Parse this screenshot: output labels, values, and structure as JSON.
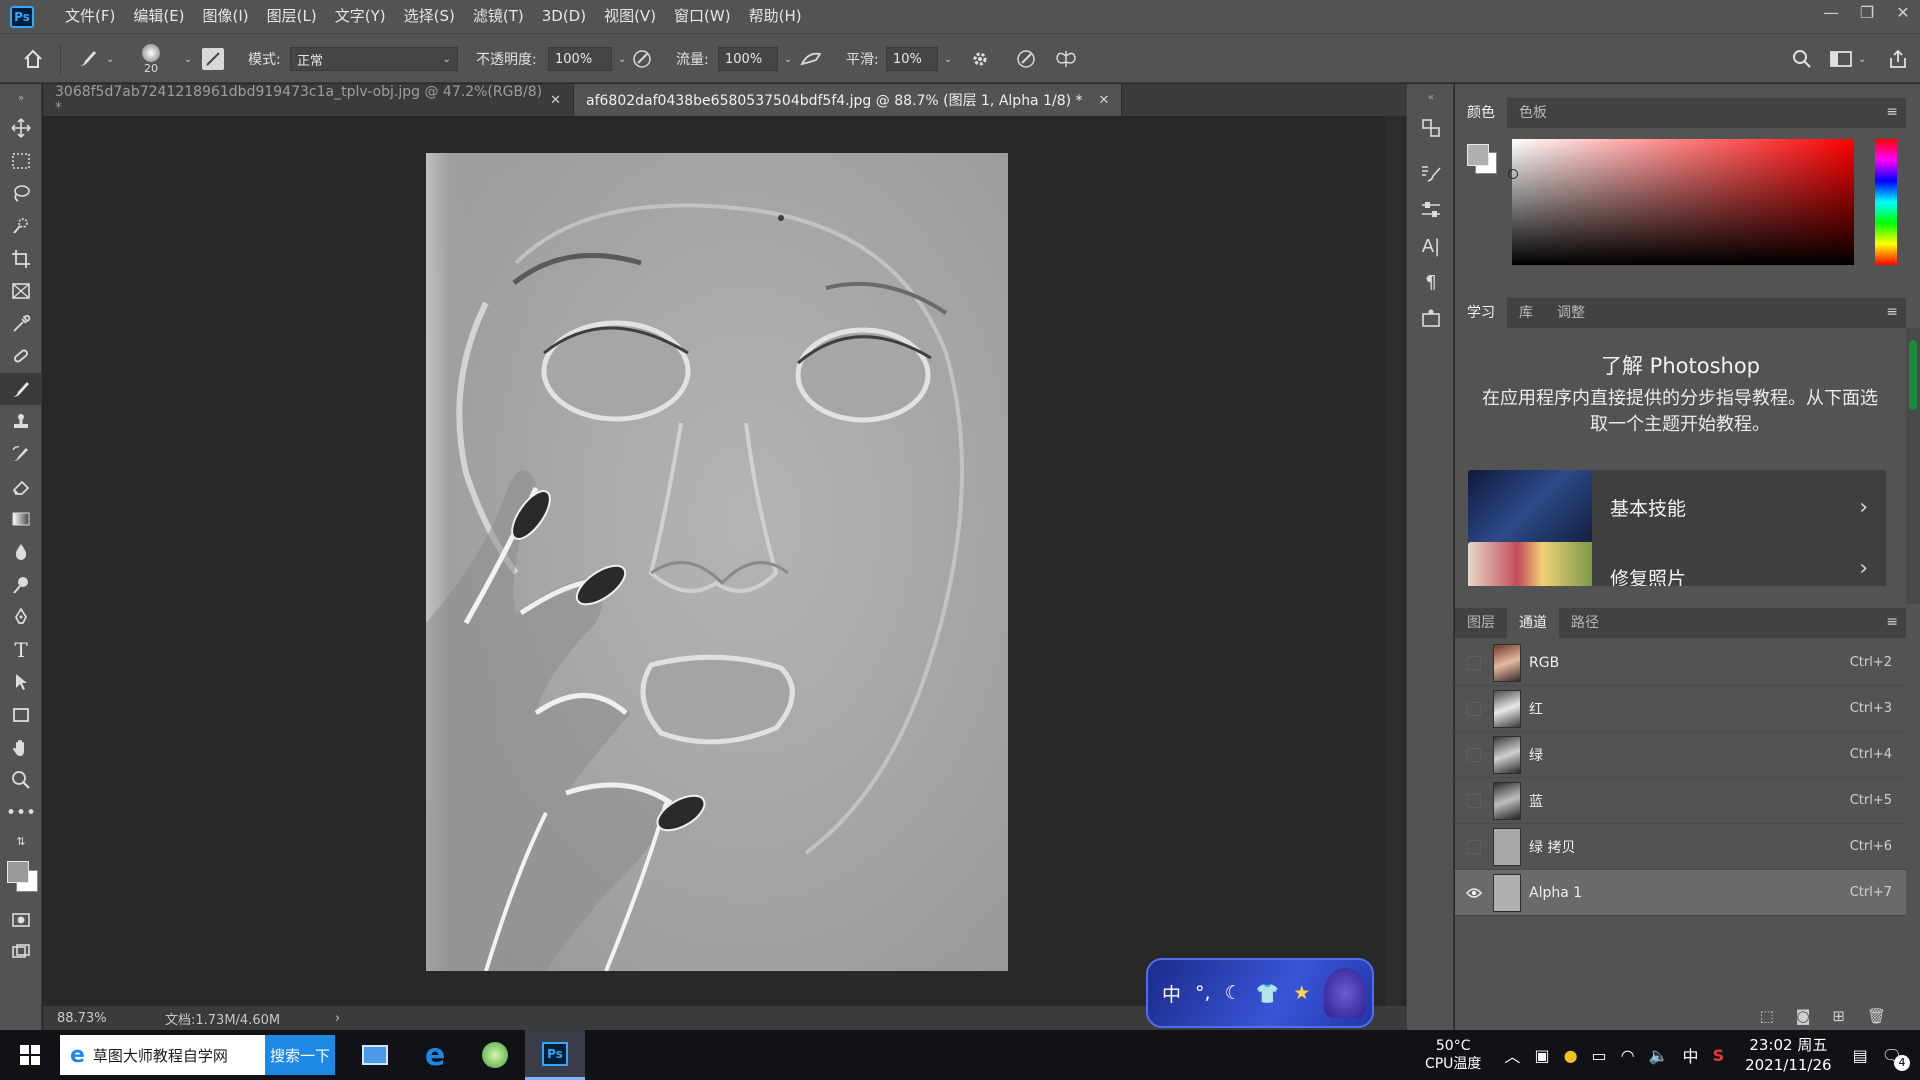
{
  "app": {
    "logo": "Ps"
  },
  "menu": [
    "文件(F)",
    "编辑(E)",
    "图像(I)",
    "图层(L)",
    "文字(Y)",
    "选择(S)",
    "滤镜(T)",
    "3D(D)",
    "视图(V)",
    "窗口(W)",
    "帮助(H)"
  ],
  "window_controls": {
    "minimize": "—",
    "restore": "❐",
    "close": "✕"
  },
  "options": {
    "brush_size": "20",
    "mode_label": "模式:",
    "mode_value": "正常",
    "opacity_label": "不透明度:",
    "opacity_value": "100%",
    "flow_label": "流量:",
    "flow_value": "100%",
    "smoothing_label": "平滑:",
    "smoothing_value": "10%"
  },
  "tabs": [
    {
      "label": "3068f5d7ab7241218961dbd919473c1a_tplv-obj.jpg @ 47.2%(RGB/8) *",
      "close": "✕",
      "active": false
    },
    {
      "label": "af6802daf0438be6580537504bdf5f4.jpg  @ 88.7% (图层 1, Alpha 1/8) *",
      "close": "✕",
      "active": true
    }
  ],
  "status": {
    "zoom": "88.73%",
    "doc": "文档:1.73M/4.60M",
    "arrow": "›"
  },
  "color_panel": {
    "tabs": [
      "颜色",
      "色板"
    ]
  },
  "learn_panel": {
    "tabs": [
      "学习",
      "库",
      "调整"
    ],
    "title": "了解 Photoshop",
    "description": "在应用程序内直接提供的分步指导教程。从下面选取一个主题开始教程。",
    "cards": [
      {
        "label": "基本技能",
        "chevron": "›"
      },
      {
        "label": "修复照片",
        "chevron": "›"
      }
    ]
  },
  "channels_panel": {
    "tabs": [
      "图层",
      "通道",
      "路径"
    ],
    "channels": [
      {
        "name": "RGB",
        "shortcut": "Ctrl+2",
        "visible": false
      },
      {
        "name": "红",
        "shortcut": "Ctrl+3",
        "visible": false
      },
      {
        "name": "绿",
        "shortcut": "Ctrl+4",
        "visible": false
      },
      {
        "name": "蓝",
        "shortcut": "Ctrl+5",
        "visible": false
      },
      {
        "name": "绿 拷贝",
        "shortcut": "Ctrl+6",
        "visible": false
      },
      {
        "name": "Alpha 1",
        "shortcut": "Ctrl+7",
        "visible": true
      }
    ]
  },
  "ime": {
    "label": "中"
  },
  "taskbar": {
    "search_text": "草图大师教程自学网",
    "search_button": "搜索一下",
    "cpu_temp": "50°C",
    "cpu_label": "CPU温度",
    "ime_indicator": "中",
    "time": "23:02 周五",
    "date": "2021/11/26",
    "notification_badge": "4"
  },
  "colors": {
    "accent": "#31a8ff",
    "panel_bg": "#535353",
    "canvas_bg": "#282828"
  }
}
